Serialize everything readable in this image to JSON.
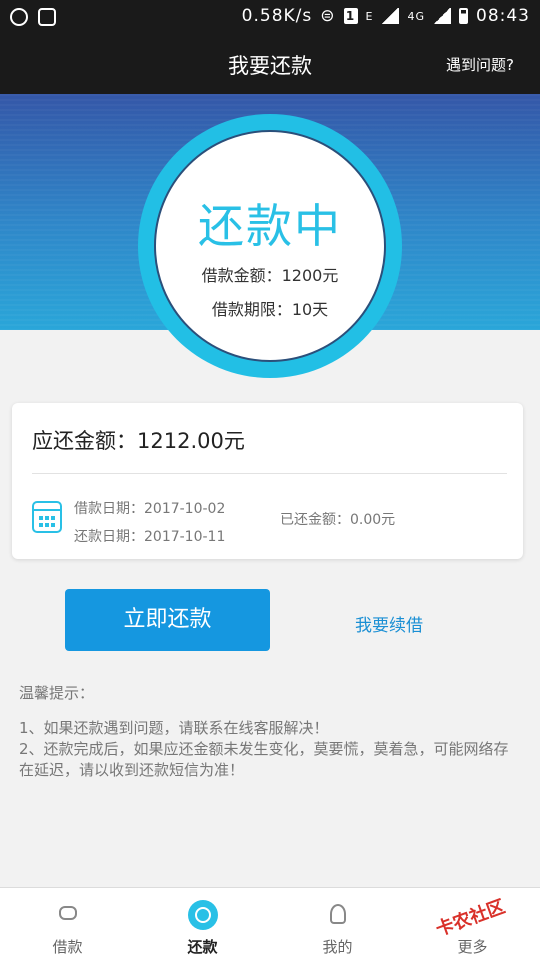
{
  "status_bar": {
    "speed": "0.58K/s",
    "network_e": "E",
    "network_4g": "4G",
    "sim_badge": "1",
    "time": "08:43"
  },
  "header": {
    "title": "我要还款",
    "help_label": "遇到问题?"
  },
  "hero": {
    "status": "还款中",
    "loan_amount": "借款金额：1200元",
    "loan_term": "借款期限：10天"
  },
  "card": {
    "due_amount": "应还金额：1212.00元",
    "loan_date": "借款日期：2017-10-02",
    "repay_date": "还款日期：2017-10-11",
    "repaid_amount": "已还金额：0.00元"
  },
  "actions": {
    "pay_now": "立即还款",
    "renew": "我要续借"
  },
  "tips": {
    "title": "温馨提示：",
    "line1": "1、如果还款遇到问题，请联系在线客服解决！",
    "line2": "2、还款完成后，如果应还金额未发生变化，莫要慌，莫着急，可能网络存在延迟，请以收到还款短信为准！"
  },
  "tabs": [
    {
      "label": "借款",
      "icon": "loan-icon"
    },
    {
      "label": "还款",
      "icon": "repay-icon"
    },
    {
      "label": "我的",
      "icon": "profile-icon"
    },
    {
      "label": "更多",
      "icon": "more-icon"
    }
  ],
  "watermark": "卡农社区",
  "colors": {
    "accent": "#29c0e6",
    "button": "#1597e0",
    "header": "#1a1a1a"
  }
}
